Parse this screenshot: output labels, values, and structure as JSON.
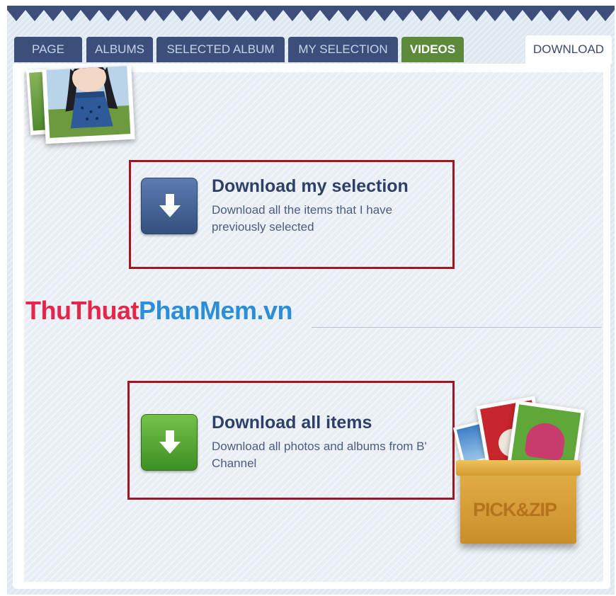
{
  "tabs": [
    {
      "label": "PAGE"
    },
    {
      "label": "ALBUMS"
    },
    {
      "label": "SELECTED ALBUM"
    },
    {
      "label": "MY SELECTION"
    },
    {
      "label": "VIDEOS"
    },
    {
      "label": "DOWNLOAD"
    }
  ],
  "active_tab": "DOWNLOAD",
  "download_selection": {
    "title": "Download my selection",
    "description": "Download all the items that I have previously selected",
    "icon": "download-arrow-icon",
    "color": "#34507f"
  },
  "download_all": {
    "title": "Download all items",
    "description": "Download all photos and albums from B' Channel",
    "icon": "download-arrow-icon",
    "color": "#3f8f24"
  },
  "watermark": {
    "part1": "ThuThuat",
    "part2": "PhanMem.vn"
  },
  "pickzip": {
    "label": "PICK&ZIP"
  },
  "colors": {
    "tab_bg": "#3b4f7a",
    "videos_tab_bg": "#5a8a3a",
    "highlight_border": "#a31621",
    "title_text": "#2e4068"
  }
}
